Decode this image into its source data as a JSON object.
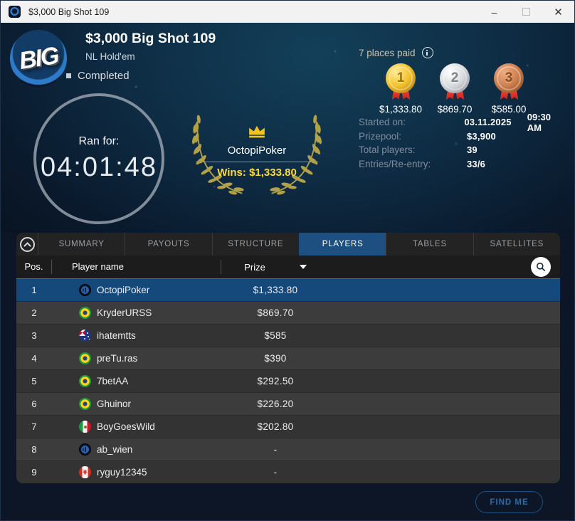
{
  "window": {
    "title": "$3,000 Big Shot 109",
    "controls": {
      "minimize": "–",
      "close": "✕"
    }
  },
  "header": {
    "logo_text": "BIG",
    "title": "$3,000 Big Shot 109",
    "game_type": "NL Hold'em",
    "status": "Completed",
    "timer": {
      "label": "Ran for:",
      "value": "04:01:48"
    },
    "winner": {
      "name": "OctopiPoker",
      "wins_label": "Wins:",
      "wins_amount": "$1,333.80"
    },
    "places_paid": "7 places paid",
    "medals": [
      {
        "tier": "gold",
        "rank": "1",
        "amount": "$1,333.80"
      },
      {
        "tier": "silver",
        "rank": "2",
        "amount": "$869.70"
      },
      {
        "tier": "bronze",
        "rank": "3",
        "amount": "$585.00"
      }
    ],
    "stats": [
      {
        "label": "Started on:",
        "value": "03.11.2025",
        "value2": "09:30 AM"
      },
      {
        "label": "Prizepool:",
        "value": "$3,900"
      },
      {
        "label": "Total players:",
        "value": "39"
      },
      {
        "label": "Entries/Re-entry:",
        "value": "33/6"
      }
    ]
  },
  "tabs": [
    {
      "label": "SUMMARY",
      "active": false
    },
    {
      "label": "PAYOUTS",
      "active": false
    },
    {
      "label": "STRUCTURE",
      "active": false
    },
    {
      "label": "PLAYERS",
      "active": true
    },
    {
      "label": "TABLES",
      "active": false
    },
    {
      "label": "SATELLITES",
      "active": false
    }
  ],
  "table": {
    "headers": {
      "pos": "Pos.",
      "player": "Player name",
      "prize": "Prize"
    },
    "rows": [
      {
        "pos": "1",
        "name": "OctopiPoker",
        "prize": "$1,333.80",
        "flag": "site",
        "selected": true
      },
      {
        "pos": "2",
        "name": "KryderURSS",
        "prize": "$869.70",
        "flag": "brazil",
        "selected": false
      },
      {
        "pos": "3",
        "name": "ihatemtts",
        "prize": "$585",
        "flag": "australia",
        "selected": false
      },
      {
        "pos": "4",
        "name": "preTu.ras",
        "prize": "$390",
        "flag": "brazil",
        "selected": false
      },
      {
        "pos": "5",
        "name": "7betAA",
        "prize": "$292.50",
        "flag": "brazil",
        "selected": false
      },
      {
        "pos": "6",
        "name": "Ghuinor",
        "prize": "$226.20",
        "flag": "brazil",
        "selected": false
      },
      {
        "pos": "7",
        "name": "BoyGoesWild",
        "prize": "$202.80",
        "flag": "mexico",
        "selected": false
      },
      {
        "pos": "8",
        "name": "ab_wien",
        "prize": "-",
        "flag": "site",
        "selected": false
      },
      {
        "pos": "9",
        "name": "ryguy12345",
        "prize": "-",
        "flag": "canada",
        "selected": false
      }
    ]
  },
  "footer": {
    "find_me": "FIND ME"
  }
}
